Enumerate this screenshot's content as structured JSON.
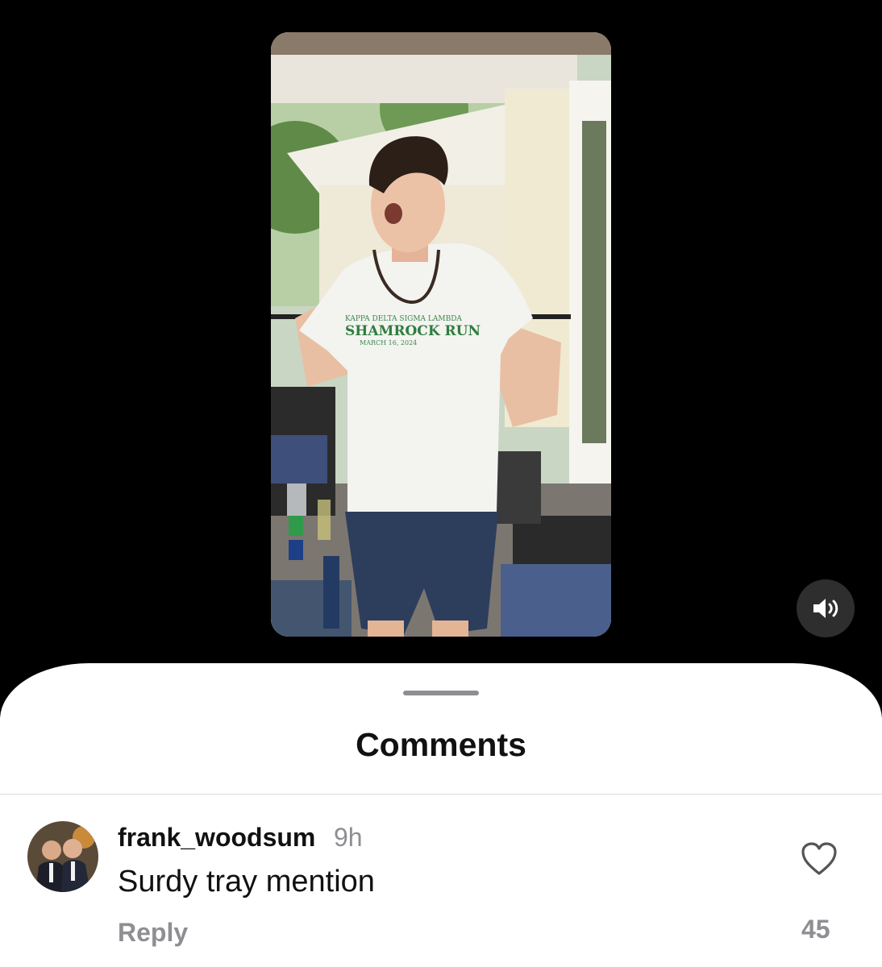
{
  "video": {
    "shirt_line1": "KAPPA DELTA SIGMA LAMBDA",
    "shirt_line2": "SHAMROCK RUN",
    "shirt_line3": "MARCH 16, 2024",
    "sound_icon": "speaker-volume-icon"
  },
  "comments_sheet": {
    "title": "Comments",
    "comments": [
      {
        "username": "frank_woodsum",
        "time": "9h",
        "text": "Surdy tray mention",
        "reply_label": "Reply",
        "like_count": "45",
        "like_icon": "heart-outline-icon"
      }
    ]
  }
}
